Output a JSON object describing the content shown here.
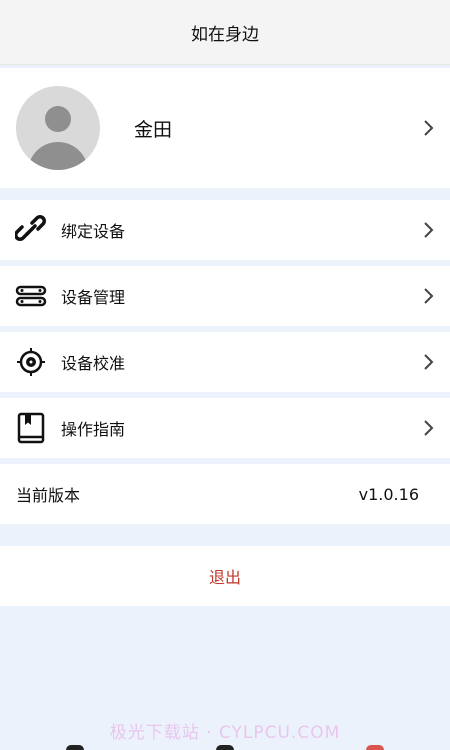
{
  "header": {
    "title": "如在身边"
  },
  "profile": {
    "name": "金田"
  },
  "menu": [
    {
      "label": "绑定设备",
      "icon": "link-icon"
    },
    {
      "label": "设备管理",
      "icon": "devices-icon"
    },
    {
      "label": "设备校准",
      "icon": "target-icon"
    },
    {
      "label": "操作指南",
      "icon": "book-icon"
    }
  ],
  "version": {
    "label": "当前版本",
    "value": "v1.0.16"
  },
  "logout": {
    "label": "退出"
  },
  "watermark": "极光下载站 · CYLPCU.COM",
  "colors": {
    "accent": "#c0392b",
    "background": "#ecf2fb"
  }
}
